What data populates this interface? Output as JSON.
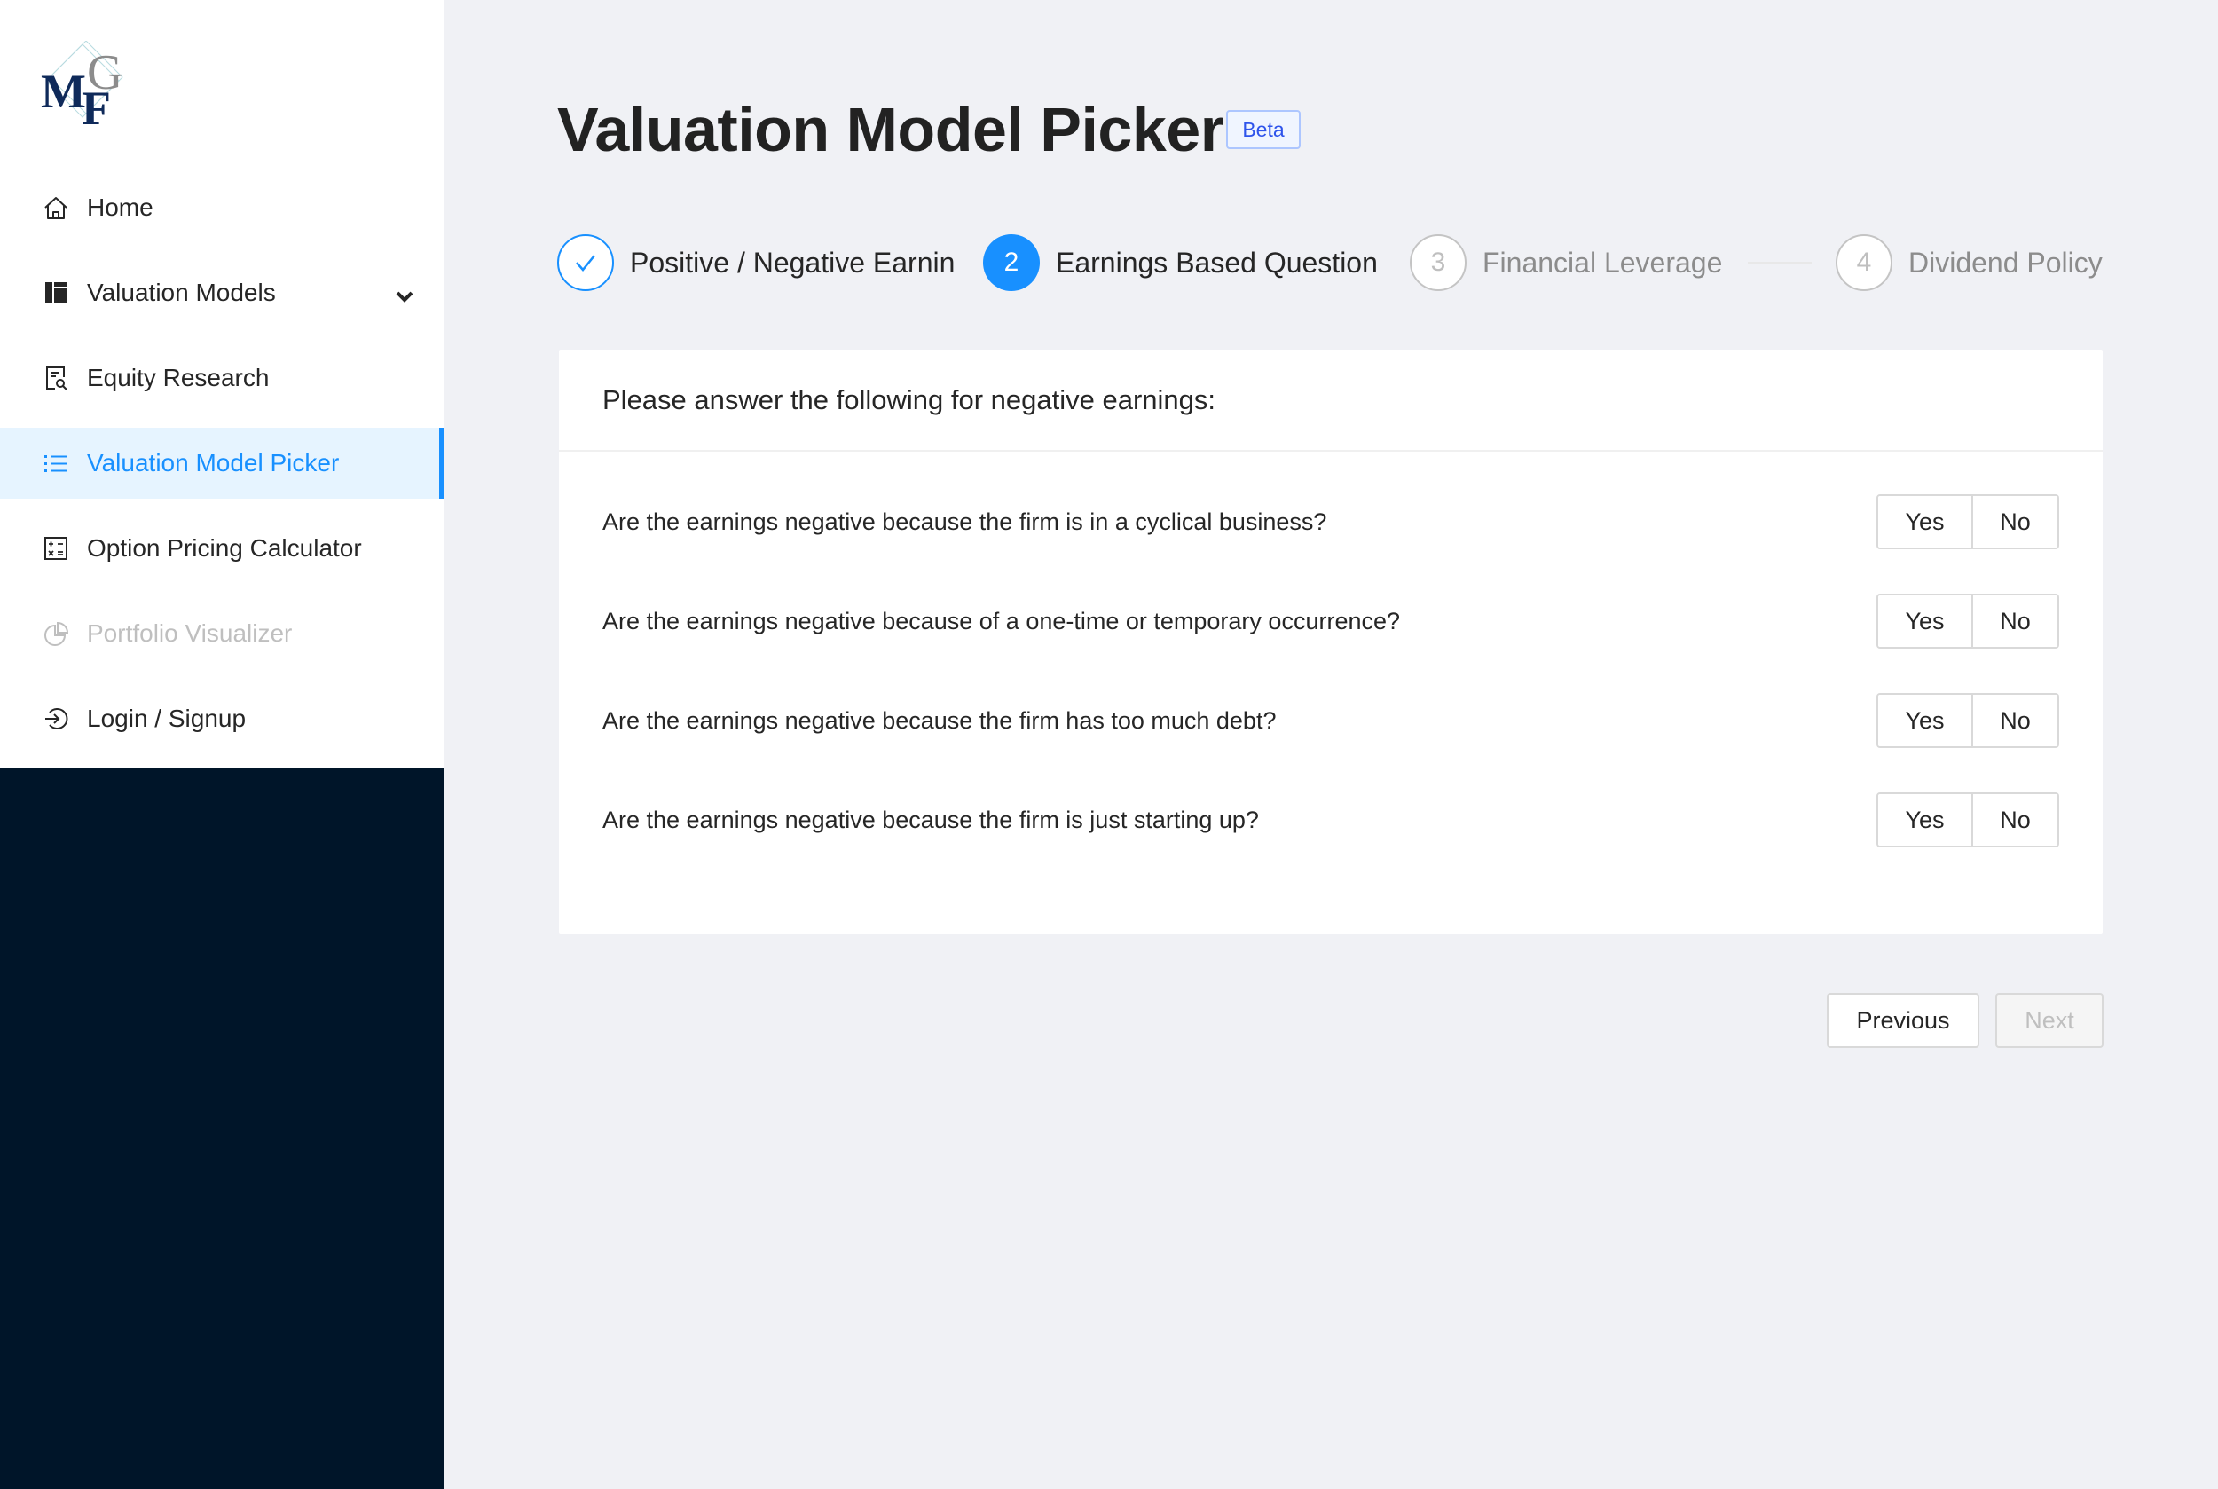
{
  "sidebar": {
    "logo_alt": "MFG",
    "items": [
      {
        "label": "Home",
        "icon": "home-icon",
        "state": "normal"
      },
      {
        "label": "Valuation Models",
        "icon": "layout-icon",
        "state": "normal",
        "has_submenu": true
      },
      {
        "label": "Equity Research",
        "icon": "file-search-icon",
        "state": "normal"
      },
      {
        "label": "Valuation Model Picker",
        "icon": "list-icon",
        "state": "active"
      },
      {
        "label": "Option Pricing Calculator",
        "icon": "calculator-icon",
        "state": "normal"
      },
      {
        "label": "Portfolio Visualizer",
        "icon": "pie-chart-icon",
        "state": "disabled"
      },
      {
        "label": "Login / Signup",
        "icon": "login-icon",
        "state": "normal"
      }
    ]
  },
  "header": {
    "title": "Valuation Model Picker",
    "badge": "Beta"
  },
  "steps": [
    {
      "number": "1",
      "label": "Positive / Negative Earnin",
      "status": "finished"
    },
    {
      "number": "2",
      "label": "Earnings Based Question",
      "status": "current"
    },
    {
      "number": "3",
      "label": "Financial Leverage",
      "status": "waiting"
    },
    {
      "number": "4",
      "label": "Dividend Policy",
      "status": "waiting"
    }
  ],
  "card": {
    "title": "Please answer the following for negative earnings:",
    "questions": [
      {
        "text": "Are the earnings negative because the firm is in a cyclical business?",
        "yes": "Yes",
        "no": "No"
      },
      {
        "text": "Are the earnings negative because of a one-time or temporary occurrence?",
        "yes": "Yes",
        "no": "No"
      },
      {
        "text": "Are the earnings negative because the firm has too much debt?",
        "yes": "Yes",
        "no": "No"
      },
      {
        "text": "Are the earnings negative because the firm is just starting up?",
        "yes": "Yes",
        "no": "No"
      }
    ]
  },
  "footer": {
    "previous_label": "Previous",
    "next_label": "Next",
    "next_disabled": true
  },
  "colors": {
    "primary": "#1890ff",
    "sidebar_dark": "#001529",
    "page_bg": "#f0f1f5",
    "beta_text": "#2f54eb"
  }
}
